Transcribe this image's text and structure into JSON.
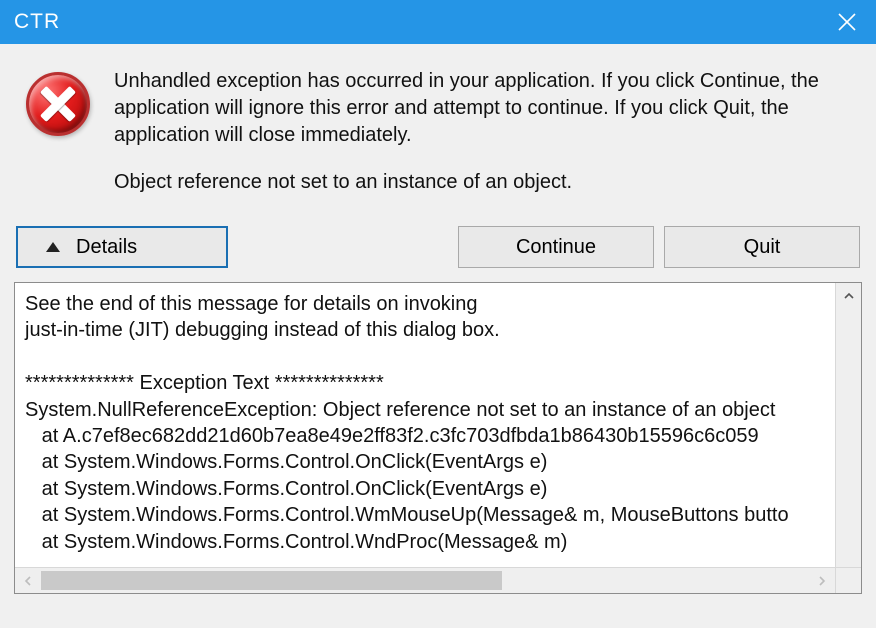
{
  "titlebar": {
    "title": "CTR",
    "close_icon": "close-icon"
  },
  "message": {
    "primary": "Unhandled exception has occurred in your application. If you click Continue, the application will ignore this error and attempt to continue. If you click Quit, the application will close immediately.",
    "secondary": "Object reference not set to an instance of an object."
  },
  "buttons": {
    "details": "Details",
    "continue": "Continue",
    "quit": "Quit"
  },
  "details_text": "See the end of this message for details on invoking\njust-in-time (JIT) debugging instead of this dialog box.\n\n************** Exception Text **************\nSystem.NullReferenceException: Object reference not set to an instance of an object\n   at A.c7ef8ec682dd21d60b7ea8e49e2ff83f2.c3fc703dfbda1b86430b15596c6c059\n   at System.Windows.Forms.Control.OnClick(EventArgs e)\n   at System.Windows.Forms.Control.OnClick(EventArgs e)\n   at System.Windows.Forms.Control.WmMouseUp(Message& m, MouseButtons butto\n   at System.Windows.Forms.Control.WndProc(Message& m)"
}
